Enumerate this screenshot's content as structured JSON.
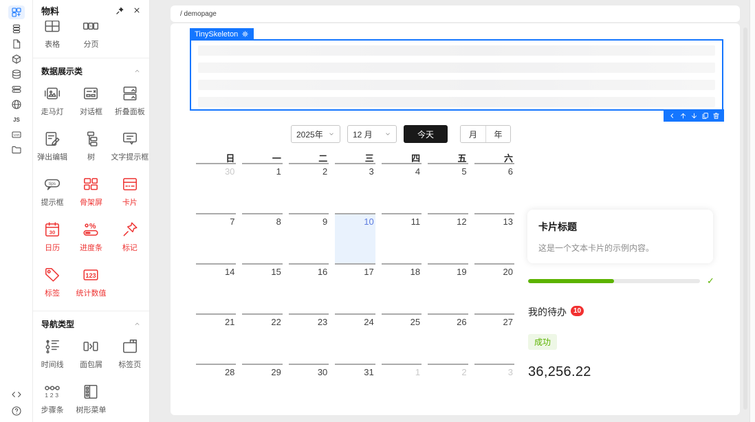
{
  "colors": {
    "accent": "#1476ff",
    "danger": "#f23030",
    "success": "#5cb300",
    "calendar_selected_text": "#5e7ce0",
    "calendar_selected_bg": "#e9f2fd"
  },
  "rail": {
    "top": [
      {
        "name": "materials",
        "icon": "components",
        "active": true
      },
      {
        "name": "outline",
        "icon": "layers",
        "active": false
      },
      {
        "name": "page",
        "icon": "page",
        "active": false
      },
      {
        "name": "block",
        "icon": "box",
        "active": false
      },
      {
        "name": "datasource",
        "icon": "database",
        "active": false
      },
      {
        "name": "resource",
        "icon": "server",
        "active": false
      },
      {
        "name": "i18n",
        "icon": "globe",
        "active": false
      },
      {
        "name": "script",
        "icon": "js",
        "active": false
      },
      {
        "name": "state",
        "icon": "variable",
        "active": false
      },
      {
        "name": "assets",
        "icon": "folder",
        "active": false
      }
    ],
    "bottom": [
      {
        "name": "source-code",
        "icon": "code"
      },
      {
        "name": "help",
        "icon": "help"
      }
    ]
  },
  "panel": {
    "title": "物料",
    "partial_items": [
      {
        "label": "表格",
        "icon": "table"
      },
      {
        "label": "分页",
        "icon": "pagination"
      }
    ],
    "sections": [
      {
        "title": "数据展示类",
        "items": [
          {
            "label": "走马灯",
            "icon": "carousel",
            "highlight": false
          },
          {
            "label": "对话框",
            "icon": "dialog",
            "highlight": false
          },
          {
            "label": "折叠面板",
            "icon": "collapse",
            "highlight": false
          },
          {
            "label": "弹出编辑",
            "icon": "popedit",
            "highlight": false
          },
          {
            "label": "树",
            "icon": "tree",
            "highlight": false
          },
          {
            "label": "文字提示框",
            "icon": "tooltip",
            "highlight": false
          },
          {
            "label": "提示框",
            "icon": "tips",
            "highlight": false
          },
          {
            "label": "骨架屏",
            "icon": "skeleton",
            "highlight": true
          },
          {
            "label": "卡片",
            "icon": "card",
            "highlight": true
          },
          {
            "label": "日历",
            "icon": "calendar",
            "highlight": true
          },
          {
            "label": "进度条",
            "icon": "progress",
            "highlight": true
          },
          {
            "label": "标记",
            "icon": "mark",
            "highlight": true
          },
          {
            "label": "标签",
            "icon": "tag",
            "highlight": true
          },
          {
            "label": "统计数值",
            "icon": "statistic",
            "highlight": true
          }
        ]
      },
      {
        "title": "导航类型",
        "items": [
          {
            "label": "时间线",
            "icon": "timeline",
            "highlight": false
          },
          {
            "label": "面包屑",
            "icon": "breadcrumb",
            "highlight": false
          },
          {
            "label": "标签页",
            "icon": "tabs",
            "highlight": false
          },
          {
            "label": "步骤条",
            "icon": "steps",
            "highlight": false
          },
          {
            "label": "树形菜单",
            "icon": "treemenu",
            "highlight": false
          }
        ]
      }
    ]
  },
  "canvas": {
    "breadcrumb": "/ demopage",
    "selection": {
      "label": "TinySkeleton",
      "toolbar_icons": [
        "chevron-left",
        "arrow-up",
        "arrow-down",
        "copy",
        "trash"
      ],
      "skeleton_rows": 4
    },
    "calendar": {
      "year": "2025年",
      "month": "12 月",
      "today_label": "今天",
      "modes": [
        "月",
        "年"
      ],
      "weekdays": [
        "日",
        "一",
        "二",
        "三",
        "四",
        "五",
        "六"
      ],
      "selected_day": "10",
      "cells": [
        {
          "d": "30",
          "muted": true
        },
        {
          "d": "1",
          "muted": false
        },
        {
          "d": "2",
          "muted": false
        },
        {
          "d": "3",
          "muted": false
        },
        {
          "d": "4",
          "muted": false
        },
        {
          "d": "5",
          "muted": false
        },
        {
          "d": "6",
          "muted": false
        },
        {
          "d": "7",
          "muted": false
        },
        {
          "d": "8",
          "muted": false
        },
        {
          "d": "9",
          "muted": false
        },
        {
          "d": "10",
          "muted": false
        },
        {
          "d": "11",
          "muted": false
        },
        {
          "d": "12",
          "muted": false
        },
        {
          "d": "13",
          "muted": false
        },
        {
          "d": "14",
          "muted": false
        },
        {
          "d": "15",
          "muted": false
        },
        {
          "d": "16",
          "muted": false
        },
        {
          "d": "17",
          "muted": false
        },
        {
          "d": "18",
          "muted": false
        },
        {
          "d": "19",
          "muted": false
        },
        {
          "d": "20",
          "muted": false
        },
        {
          "d": "21",
          "muted": false
        },
        {
          "d": "22",
          "muted": false
        },
        {
          "d": "23",
          "muted": false
        },
        {
          "d": "24",
          "muted": false
        },
        {
          "d": "25",
          "muted": false
        },
        {
          "d": "26",
          "muted": false
        },
        {
          "d": "27",
          "muted": false
        },
        {
          "d": "28",
          "muted": false
        },
        {
          "d": "29",
          "muted": false
        },
        {
          "d": "30",
          "muted": false
        },
        {
          "d": "31",
          "muted": false
        },
        {
          "d": "1",
          "muted": true
        },
        {
          "d": "2",
          "muted": true
        },
        {
          "d": "3",
          "muted": true
        }
      ]
    },
    "card": {
      "title": "卡片标题",
      "body": "这是一个文本卡片的示例内容。"
    },
    "progress": {
      "percent": 50,
      "check": "✓"
    },
    "todo": {
      "label": "我的待办",
      "badge": "10"
    },
    "tag": {
      "label": "成功"
    },
    "statistic": {
      "value": "36,256.22"
    }
  }
}
